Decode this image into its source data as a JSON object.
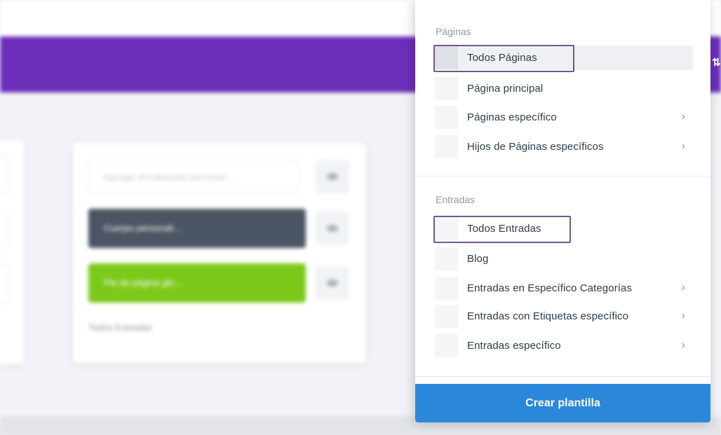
{
  "background": {
    "input_placeholder": "Agregar encabezado personal...",
    "header_block_label": "Cuerpo personali...",
    "footer_block_label": "Pie de página glo...",
    "assignment_text": "Todos Entradas"
  },
  "dropdown": {
    "sections": [
      {
        "title": "Páginas",
        "items": [
          {
            "label": "Todos Páginas",
            "has_submenu": false,
            "highlighted": true
          },
          {
            "label": "Página principal",
            "has_submenu": false
          },
          {
            "label": "Páginas específico",
            "has_submenu": true
          },
          {
            "label": "Hijos de Páginas específicos",
            "has_submenu": true
          }
        ]
      },
      {
        "title": "Entradas",
        "items": [
          {
            "label": "Todos Entradas",
            "has_submenu": false,
            "highlighted": true
          },
          {
            "label": "Blog",
            "has_submenu": false
          },
          {
            "label": "Entradas en Específico Categorías",
            "has_submenu": true
          },
          {
            "label": "Entradas con Etiquetas específico",
            "has_submenu": true
          },
          {
            "label": "Entradas específico",
            "has_submenu": true
          }
        ]
      }
    ],
    "chevron_glyph": "›",
    "create_button_label": "Crear plantilla"
  },
  "colors": {
    "purple_header": "#6c2eb9",
    "primary_blue": "#2b87da",
    "green_block": "#7cc91b",
    "dark_block": "#4b5563",
    "highlight_outline": "#6e5a8a"
  },
  "icons": [
    "chevron-right-icon",
    "eye-icon",
    "pencil-icon",
    "trash-icon",
    "sort-arrows-icon"
  ]
}
